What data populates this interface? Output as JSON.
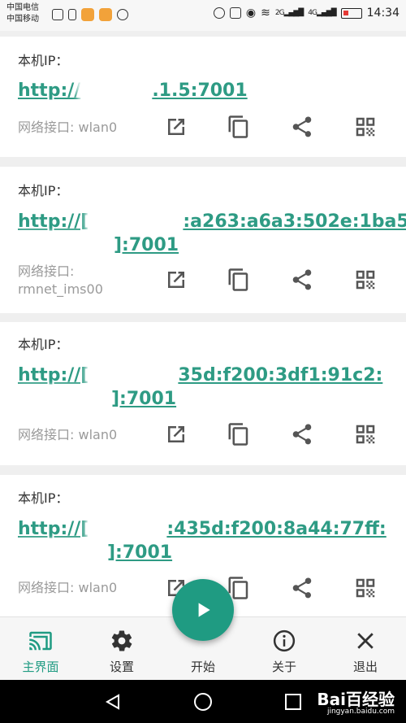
{
  "status_bar": {
    "carrier_1": "中国电信",
    "carrier_2": "中国移动",
    "sig1": "2G",
    "sig2": "4G",
    "time": "14:34"
  },
  "cards": [
    {
      "label": "本机IP：",
      "url_line1_pre": "http://",
      "url_line1_post": ".1.5:7001",
      "url_line2": "",
      "iface": "网络接口: wlan0"
    },
    {
      "label": "本机IP：",
      "url_line1_pre": "http://[",
      "url_line1_post": ":a263:a6a3:502e:1ba5:",
      "url_line2": "]:7001",
      "iface": "网络接口:\nrmnet_ims00"
    },
    {
      "label": "本机IP：",
      "url_line1_pre": "http://[",
      "url_line1_post": "35d:f200:3df1:91c2:",
      "url_line2": "]:7001",
      "iface": "网络接口: wlan0"
    },
    {
      "label": "本机IP：",
      "url_line1_pre": "http://[",
      "url_line1_post": ":435d:f200:8a44:77ff:",
      "url_line2": "]:7001",
      "iface": "网络接口: wlan0"
    }
  ],
  "nav": {
    "home": "主界面",
    "settings": "设置",
    "start": "开始",
    "about": "关于",
    "exit": "退出"
  },
  "colors": {
    "accent": "#1f9b82",
    "link": "#2e9b84"
  },
  "watermark": {
    "brand": "Bai百经验",
    "site": "jingyan.baidu.com"
  }
}
